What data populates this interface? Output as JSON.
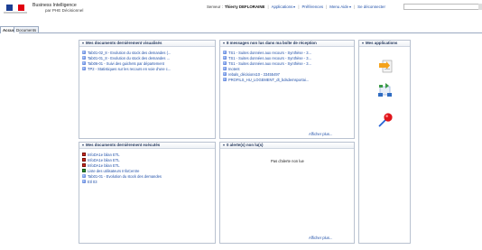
{
  "header": {
    "app_title": "Business Intelligence",
    "app_subtitle": "par PHE Décisionnel",
    "server_label": "Serveur :",
    "user_name": "Thierry DEFLORAINE",
    "links": {
      "applications": "Applications",
      "preferences": "Préférences",
      "help_menu": "Menu Aide",
      "logout": "Se déconnecter"
    },
    "search": {
      "value": ""
    }
  },
  "tabs": [
    {
      "label": "Accueil",
      "active": true
    },
    {
      "label": "Documents",
      "active": false
    }
  ],
  "portlets": {
    "recent_viewed": {
      "title": "Mes documents dernièrement visualisés",
      "items": [
        "Tab01-02_8 - Evolution du stock des demandes (...",
        "Tab01-01_8 - Evolution du stock des demandes ...",
        "Tab06-01 - Suivi des guichets par département",
        "TP2 - Statistiques sur les recours en voie d'une c..."
      ]
    },
    "inbox": {
      "title": "8 messages non lus dans ma boîte de réception",
      "items": [
        "TS1 - Suites données aux recours - Synthèse - 3...",
        "TS1 - Suites données aux recours - Synthèse - 3...",
        "TS1 - Suites données aux recours - Synthèse - 3...",
        "Inotent",
        "rebals_décisions10 - 33455497",
        "PROFILS_HU_LOGEMENT_dt_bdsdemsportai..."
      ],
      "more": "Afficher plus..."
    },
    "applications": {
      "title": "Mes applications",
      "icons": [
        "import-document-icon",
        "publication-icon",
        "push-pin-icon"
      ]
    },
    "recent_run": {
      "title": "Mes documents dernièrement exécutés",
      "items": [
        {
          "label": "InfoDA1e bilan ETL",
          "icon": "pdf"
        },
        {
          "label": "InfoDA1e bilan ETL",
          "icon": "pdf"
        },
        {
          "label": "InfoDA1e bilan ETL",
          "icon": "pdf"
        },
        {
          "label": "Liste des utilisateurs InfoCentre",
          "icon": "xls"
        },
        {
          "label": "Tab01-01 - Evolution du stock des demandes",
          "icon": "blue"
        },
        {
          "label": "Etl 03",
          "icon": "blue"
        }
      ]
    },
    "alerts": {
      "title": "0 alerte(s) non lu(s)",
      "message": "Pas d'alerte non lue",
      "more": "Afficher plus..."
    }
  },
  "colors": {
    "link": "#1f4fa8",
    "portlet_title": "#23375c",
    "border": "#b9c2d0"
  }
}
